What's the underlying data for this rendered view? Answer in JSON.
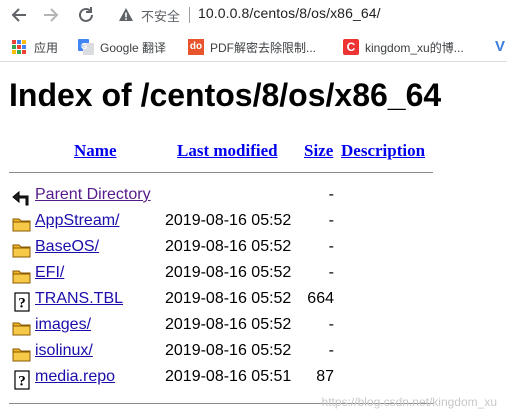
{
  "browser": {
    "security_label": "不安全",
    "url": "10.0.0.8/centos/8/os/x86_64/",
    "bookmarks": [
      {
        "label": "应用",
        "icon": "apps-icon"
      },
      {
        "label": "Google 翻译",
        "icon": "google-translate-icon"
      },
      {
        "label": "PDF解密去除限制...",
        "icon": "pdf-icon",
        "icon_text": "do"
      },
      {
        "label": "kingdom_xu的博...",
        "icon": "csdn-icon",
        "icon_text": "C"
      },
      {
        "label": "",
        "icon": "v-icon",
        "icon_text": "V"
      }
    ]
  },
  "page": {
    "title": "Index of /centos/8/os/x86_64",
    "columns": {
      "name": "Name",
      "last_modified": "Last modified",
      "size": "Size",
      "description": "Description"
    },
    "entries": [
      {
        "icon": "parent-directory-icon",
        "name": "Parent Directory",
        "date": "",
        "size": "-",
        "visited": true
      },
      {
        "icon": "folder-icon",
        "name": "AppStream/",
        "date": "2019-08-16 05:52",
        "size": "-",
        "visited": false
      },
      {
        "icon": "folder-icon",
        "name": "BaseOS/",
        "date": "2019-08-16 05:52",
        "size": "-",
        "visited": false
      },
      {
        "icon": "folder-icon",
        "name": "EFI/",
        "date": "2019-08-16 05:52",
        "size": "-",
        "visited": false
      },
      {
        "icon": "unknown-file-icon",
        "name": "TRANS.TBL",
        "date": "2019-08-16 05:52",
        "size": "664",
        "visited": false
      },
      {
        "icon": "folder-icon",
        "name": "images/",
        "date": "2019-08-16 05:52",
        "size": "-",
        "visited": false
      },
      {
        "icon": "folder-icon",
        "name": "isolinux/",
        "date": "2019-08-16 05:52",
        "size": "-",
        "visited": false
      },
      {
        "icon": "unknown-file-icon",
        "name": "media.repo",
        "date": "2019-08-16 05:51",
        "size": "87",
        "visited": false
      }
    ],
    "watermark": "https://blog.csdn.net/kingdom_xu"
  }
}
